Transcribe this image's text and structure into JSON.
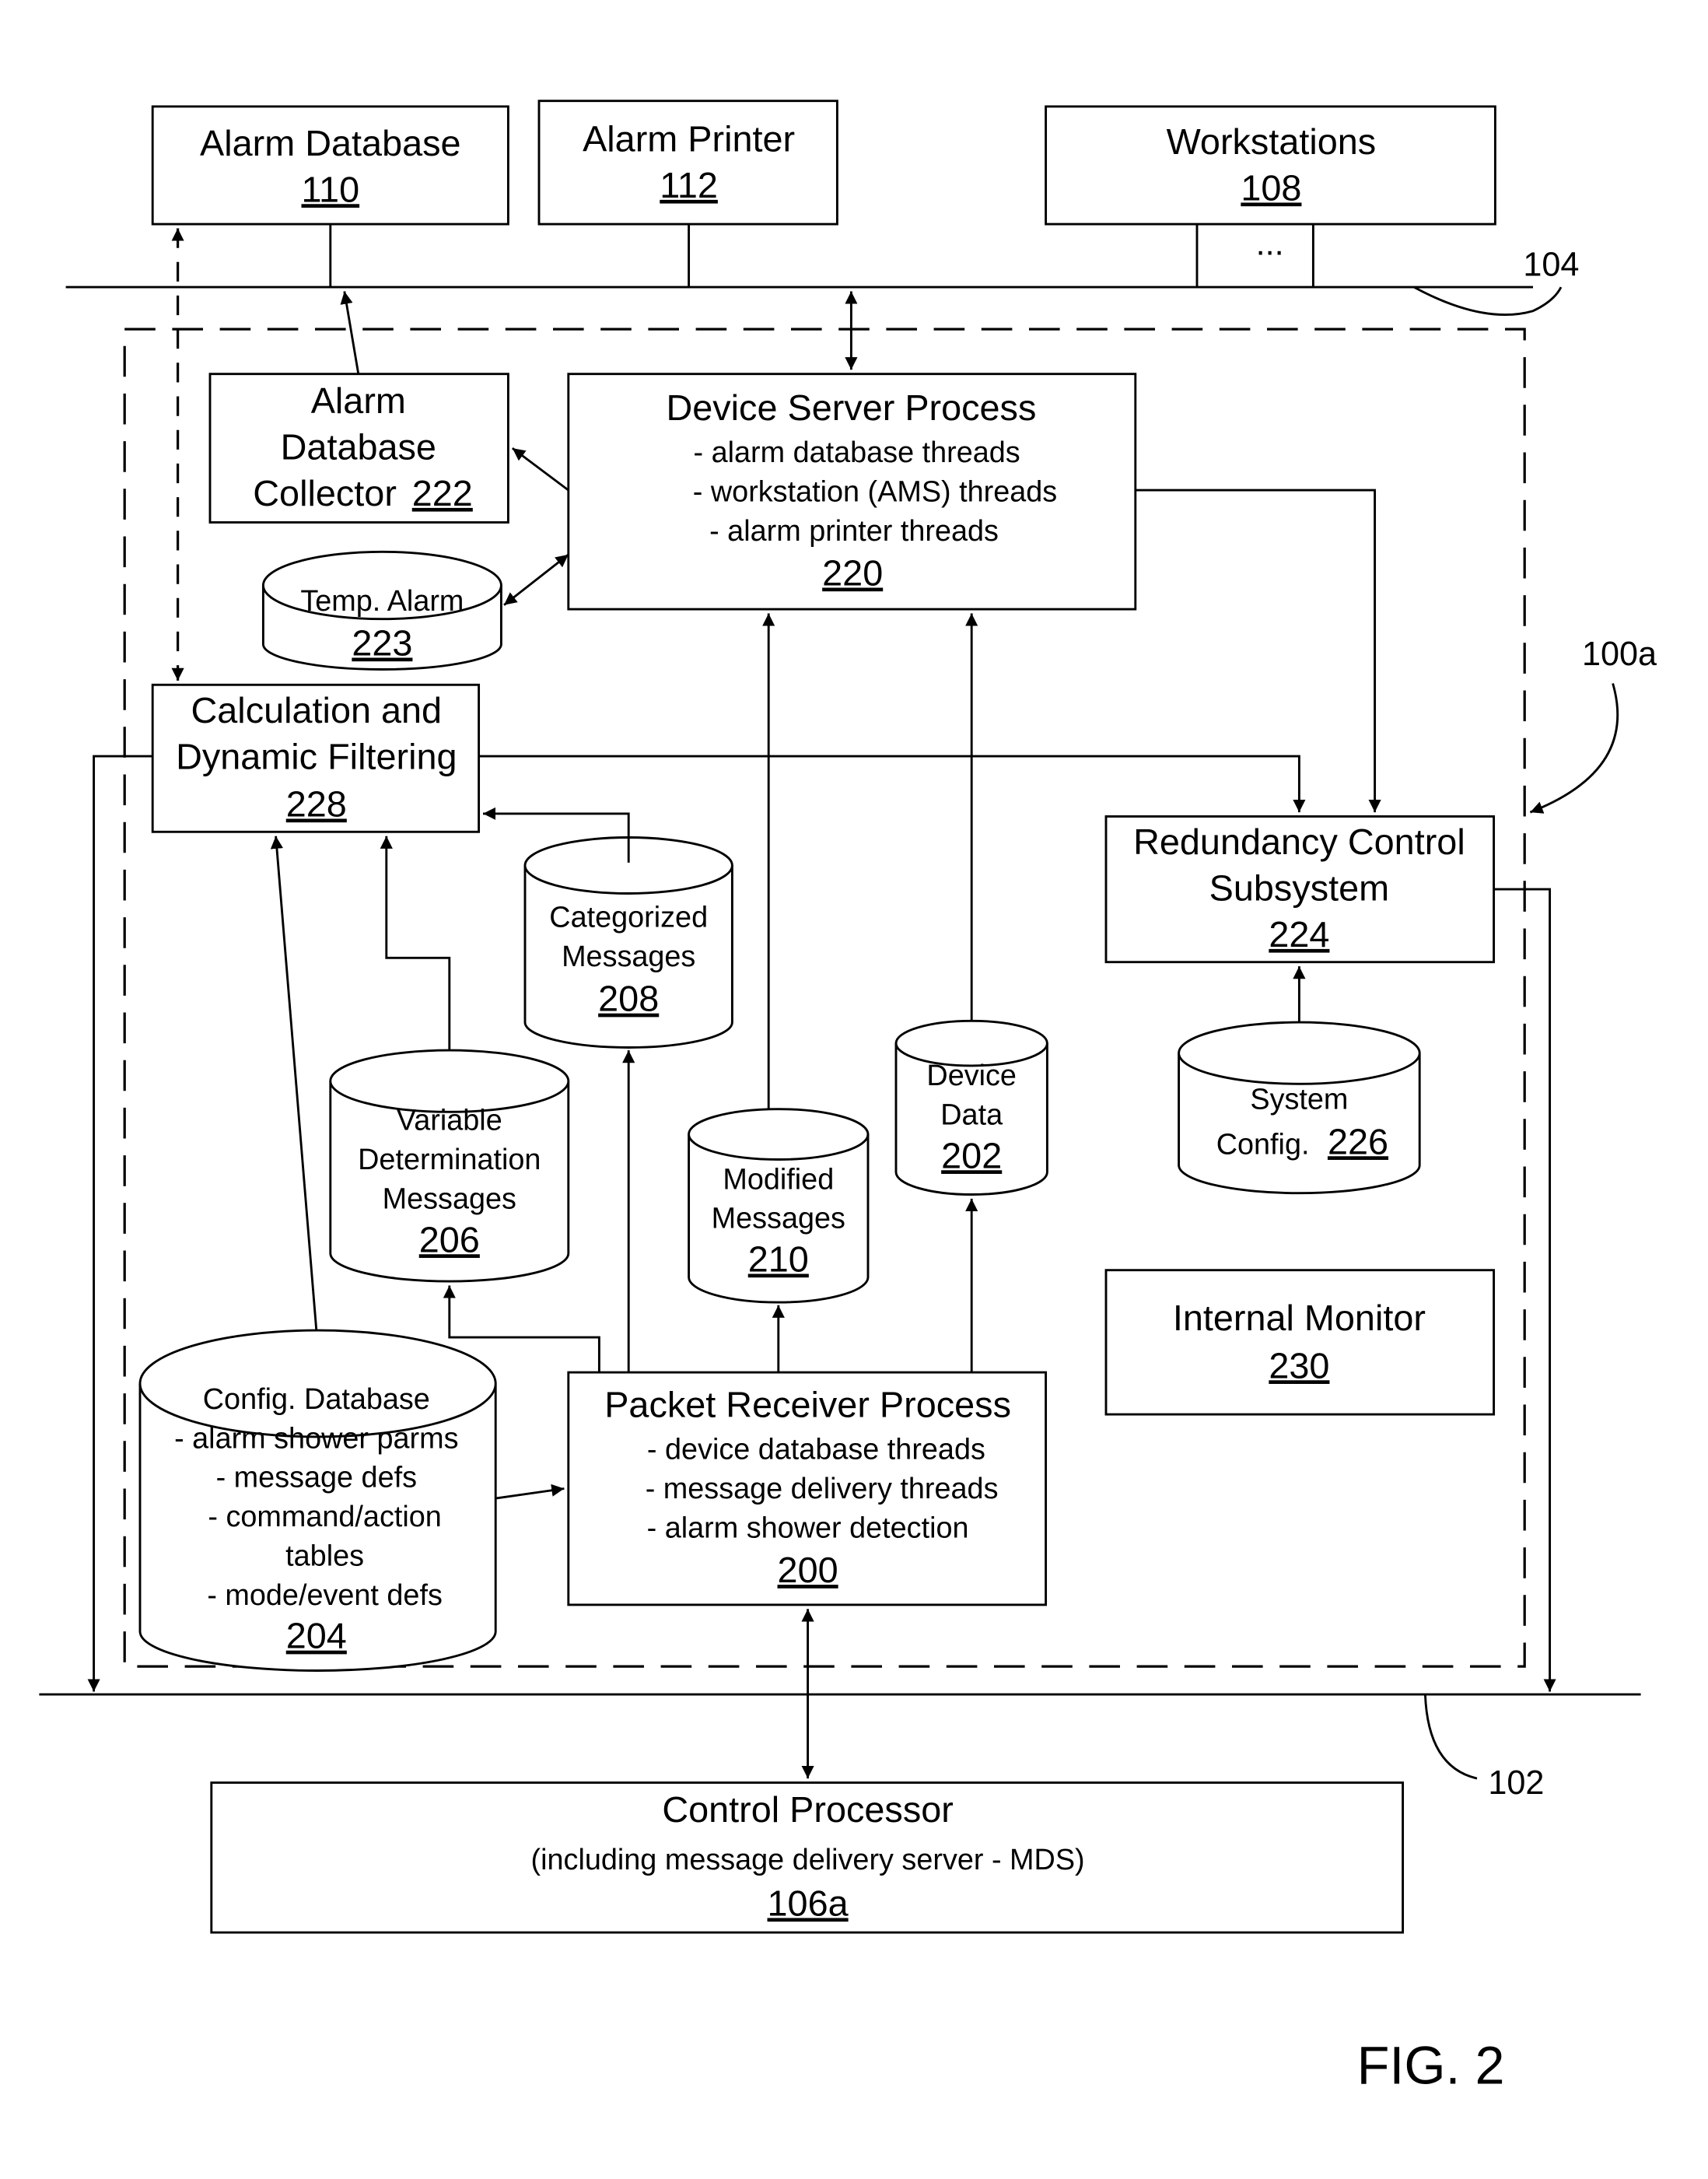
{
  "figure_label": "FIG. 2",
  "refs": {
    "bus_top": "104",
    "bus_bottom": "102",
    "system": "100a"
  },
  "nodes": {
    "alarm_db": {
      "title": "Alarm Database",
      "num": "110"
    },
    "alarm_printer": {
      "title": "Alarm Printer",
      "num": "112"
    },
    "workstations": {
      "title": "Workstations",
      "num": "108",
      "ellipsis": "..."
    },
    "collector": {
      "lines": [
        "Alarm",
        "Database",
        "Collector"
      ],
      "num": "222"
    },
    "device_server": {
      "title": "Device Server Process",
      "items": [
        "- alarm database threads",
        "- workstation (AMS) threads",
        "- alarm printer threads"
      ],
      "num": "220"
    },
    "temp_alarm": {
      "title": "Temp. Alarm",
      "num": "223"
    },
    "calc": {
      "lines": [
        "Calculation and",
        "Dynamic Filtering"
      ],
      "num": "228"
    },
    "categorized": {
      "lines": [
        "Categorized",
        "Messages"
      ],
      "num": "208"
    },
    "redundancy": {
      "lines": [
        "Redundancy Control",
        "Subsystem"
      ],
      "num": "224"
    },
    "variable": {
      "lines": [
        "Variable",
        "Determination",
        "Messages"
      ],
      "num": "206"
    },
    "modified": {
      "lines": [
        "Modified",
        "Messages"
      ],
      "num": "210"
    },
    "device_data": {
      "lines": [
        "Device",
        "Data"
      ],
      "num": "202"
    },
    "sys_config": {
      "lines": [
        "System",
        "Config."
      ],
      "num": "226"
    },
    "internal_monitor": {
      "title": "Internal Monitor",
      "num": "230"
    },
    "config_db": {
      "title": "Config. Database",
      "items": [
        "- alarm shower parms",
        "- message defs",
        "- command/action",
        "tables",
        "- mode/event defs"
      ],
      "num": "204"
    },
    "packet_receiver": {
      "title": "Packet Receiver Process",
      "items": [
        "- device database threads",
        "- message delivery threads",
        "- alarm shower detection"
      ],
      "num": "200"
    },
    "control_processor": {
      "title": "Control Processor",
      "subtitle": "(including message delivery server - MDS)",
      "num": "106a"
    }
  }
}
